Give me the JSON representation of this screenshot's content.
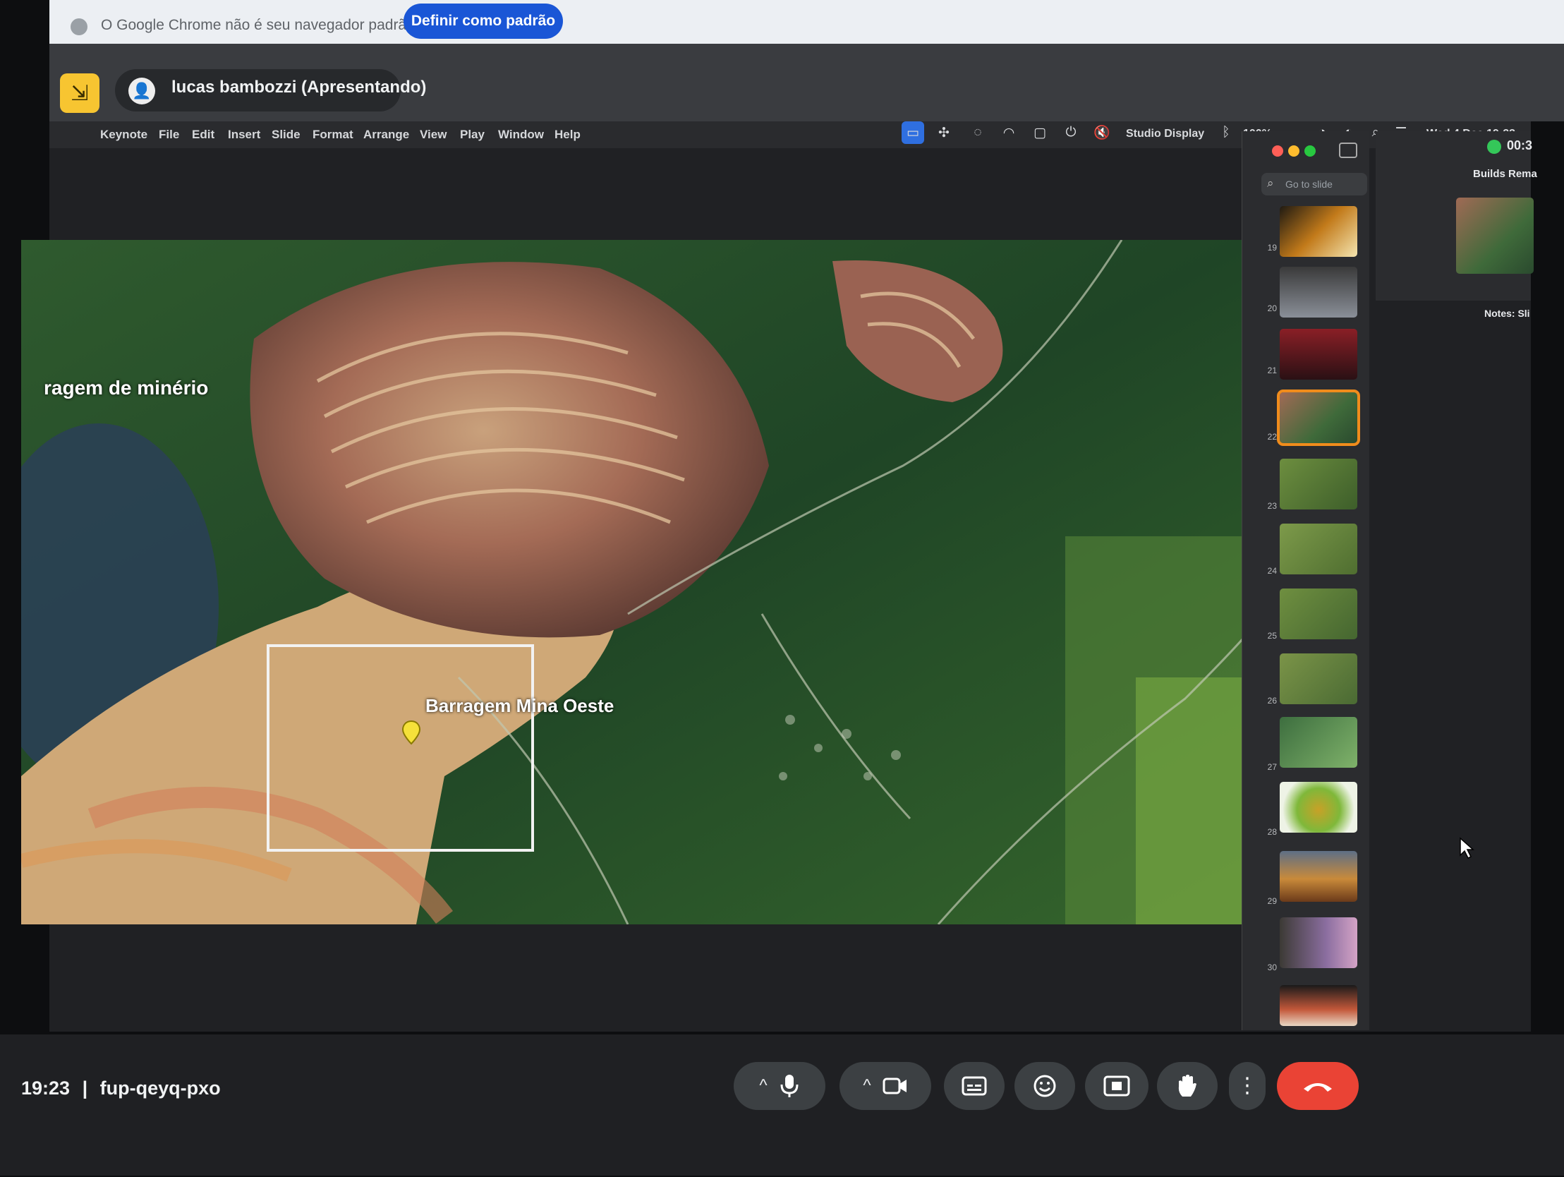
{
  "chrome_infobar": {
    "message": "O Google Chrome não é seu navegador padrão",
    "button_label": "Definir como padrão"
  },
  "presenter": {
    "name_label": "lucas bambozzi (Apresentando)"
  },
  "mac_menu": {
    "items": [
      "Keynote",
      "File",
      "Edit",
      "Insert",
      "Slide",
      "Format",
      "Arrange",
      "View",
      "Play",
      "Window",
      "Help"
    ],
    "status_clock": "Wed 4 Dec 19:23",
    "battery": "100%",
    "audio_label": "Studio Display"
  },
  "slide": {
    "labels": {
      "top_left": "ragem de minério",
      "dam": "Barragem Mina Oeste"
    }
  },
  "navigator": {
    "search_placeholder": "Go to slide",
    "slide_numbers": [
      "19",
      "20",
      "21",
      "22",
      "23",
      "24",
      "25",
      "26",
      "27",
      "28",
      "29",
      "30",
      ""
    ],
    "active_slide": "22"
  },
  "presenter_panel": {
    "timer": "00:3",
    "build_label": "Builds Rema",
    "notes_label": "Notes: Sli"
  },
  "meet_controls": {
    "meeting_time": "19:23",
    "separator": "|",
    "meeting_code": "fup-qeyq-pxo"
  },
  "colors": {
    "meet_blue": "#1a56d6",
    "leave_red": "#ea4335",
    "active_slide_orange": "#f08c1c",
    "presenting_yellow": "#f7c531"
  }
}
